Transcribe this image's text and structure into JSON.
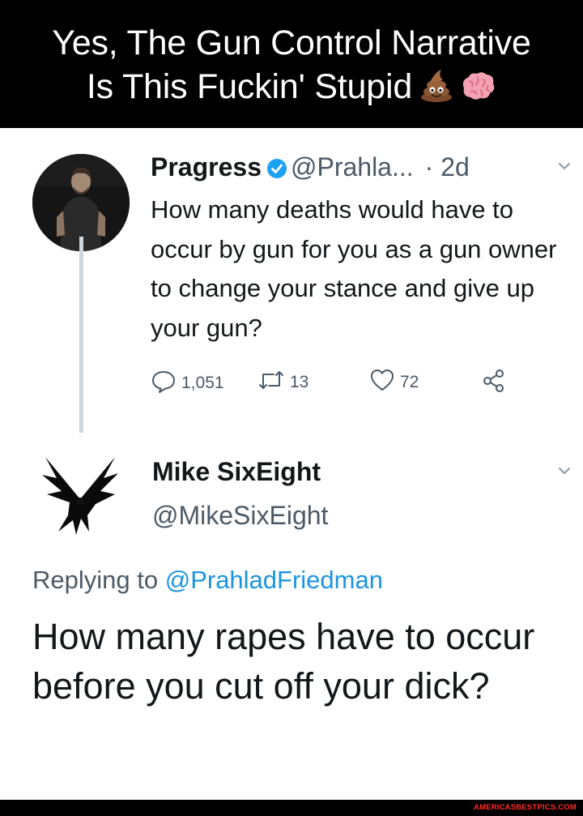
{
  "banner": {
    "line1": "Yes, The Gun Control Narrative",
    "line2": "Is This Fuckin' Stupid",
    "emojis": [
      "pile-of-poo-icon",
      "brain-icon"
    ]
  },
  "tweet1": {
    "name": "Pragress",
    "verified": true,
    "handle": "@Prahla...",
    "time": "· 2d",
    "text": "How many deaths would have to occur by gun for you as a gun owner to change your stance and give up your gun?",
    "replies": "1,051",
    "retweets": "13",
    "likes": "72"
  },
  "tweet2": {
    "name": "Mike SixEight",
    "handle": "@MikeSixEight",
    "replying_prefix": "Replying to ",
    "replying_handle": "@PrahladFriedman",
    "text": "How many rapes have to occur before you cut off your dick?"
  },
  "footer": {
    "watermark": "AMERICASBESTPICS.COM"
  },
  "colors": {
    "banner_bg": "#000000",
    "text_primary": "#14171a",
    "text_secondary": "#4b5a66",
    "link": "#1b95e0",
    "verified": "#1da1f2",
    "watermark": "#ff2a2a"
  }
}
